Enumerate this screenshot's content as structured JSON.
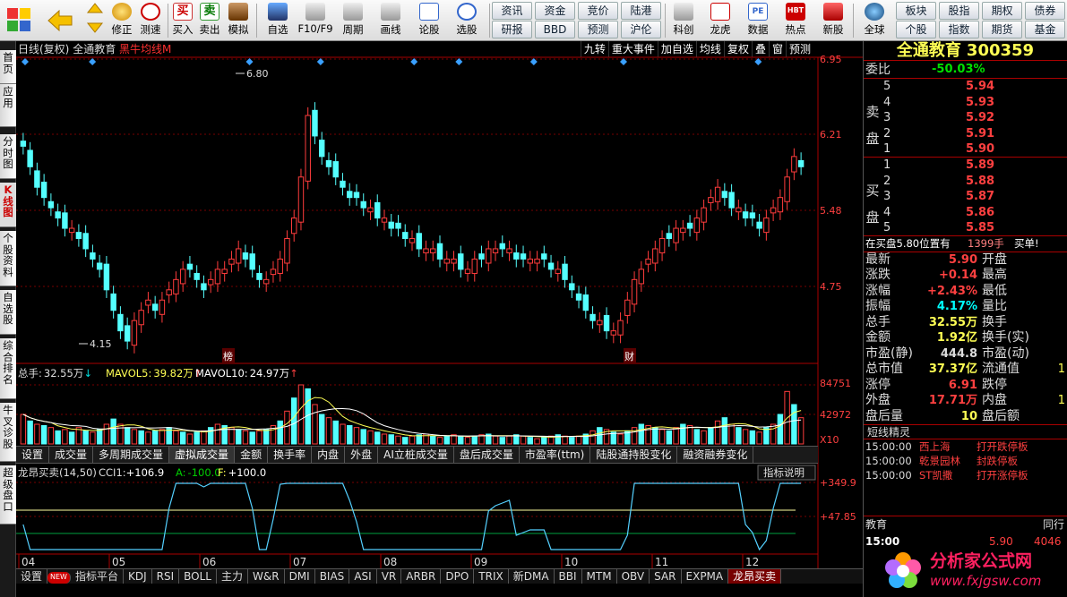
{
  "toolbar": {
    "buttons": [
      "修正",
      "测速",
      "买入",
      "卖出",
      "模拟",
      "自选",
      "F10/F9",
      "周期",
      "画线",
      "论股",
      "选股",
      "科创",
      "龙虎",
      "数据",
      "热点",
      "新股",
      "全球"
    ],
    "buy_glyph": "买",
    "sell_glyph": "卖",
    "grid_buttons": {
      "row1": [
        "资讯",
        "资金",
        "竞价",
        "陆港"
      ],
      "row2": [
        "研报",
        "BBD",
        "预测",
        "沪伦"
      ],
      "right_row1": [
        "板块",
        "股指",
        "期权",
        "债券"
      ],
      "right_row2": [
        "个股",
        "指数",
        "期货",
        "基金"
      ]
    },
    "pe_badge": "PE",
    "hbt_badge": "HBT"
  },
  "sidebar": [
    "首页",
    "应用",
    "分时图",
    "K线图",
    "个股资料",
    "自选股",
    "综合排名",
    "牛叉诊股",
    "超级盘口"
  ],
  "chart": {
    "header_prefix": "日线(复权)",
    "stock_name": "全通教育",
    "formula": "黑牛均线M",
    "tools": [
      "九转",
      "重大事件",
      "加自选",
      "均线",
      "复权",
      "叠",
      "窗",
      "预测"
    ],
    "price_axis": [
      "6.95",
      "6.21",
      "5.48",
      "4.75"
    ],
    "high_label": "6.80",
    "low_label": "4.15",
    "event_bang": "榜",
    "event_cai": "财",
    "vol_header": {
      "zongshou_label": "总手:",
      "zongshou": "32.55万",
      "mavol5_label": "MAVOL5:",
      "mavol5": "39.82万",
      "mavol10_label": "MAVOL10:",
      "mavol10": "24.97万"
    },
    "vol_axis": [
      "84751",
      "42972"
    ],
    "vol_unit": "X10",
    "ind_tabs": [
      "设置",
      "成交量",
      "多周期成交量",
      "虚拟成交量",
      "金额",
      "换手率",
      "内盘",
      "外盘",
      "AI立桩成交量",
      "盘后成交量",
      "市盈率(ttm)",
      "陆股通持股变化",
      "融资融券变化"
    ],
    "ind_tab_selected": "虚拟成交量",
    "ind_explain": "指标说明",
    "ind_header": {
      "name": "龙昂买卖(14,50)",
      "cci_label": "CCI1:",
      "cci": "+106.9",
      "a_label": "A:",
      "a": "-100.0",
      "f_label": "F:",
      "f": "+100.0"
    },
    "ind_axis": [
      "+349.9",
      "+47.85"
    ],
    "months": [
      "04",
      "05",
      "06",
      "07",
      "08",
      "09",
      "10",
      "11",
      "12"
    ],
    "bottom_tabs": [
      "设置",
      "指标平台",
      "KDJ",
      "RSI",
      "BOLL",
      "主力",
      "W&R",
      "DMI",
      "BIAS",
      "ASI",
      "VR",
      "ARBR",
      "DPO",
      "TRIX",
      "新DMA",
      "BBI",
      "MTM",
      "OBV",
      "SAR",
      "EXPMA",
      "龙昂买卖"
    ],
    "new_badge": "NEW"
  },
  "chart_data": {
    "type": "candlestick",
    "title": "全通教育 日线(复权)",
    "price_range": [
      4.0,
      6.95
    ],
    "high": 6.8,
    "low": 4.15,
    "close_series": [
      6.1,
      5.9,
      5.7,
      5.6,
      5.5,
      5.4,
      5.3,
      5.3,
      5.2,
      5.1,
      5.0,
      4.9,
      4.7,
      4.5,
      4.3,
      4.2,
      4.4,
      4.5,
      4.6,
      4.5,
      4.6,
      4.7,
      4.8,
      4.9,
      4.9,
      4.8,
      4.7,
      4.8,
      4.9,
      4.9,
      5.0,
      5.1,
      5.0,
      4.9,
      4.8,
      4.8,
      4.9,
      5.0,
      5.2,
      5.4,
      5.8,
      6.4,
      6.2,
      6.0,
      5.9,
      5.8,
      5.7,
      5.6,
      5.6,
      5.5,
      5.5,
      5.4,
      5.4,
      5.3,
      5.3,
      5.2,
      5.2,
      5.1,
      5.1,
      5.1,
      5.0,
      5.0,
      5.0,
      4.9,
      4.9,
      5.0,
      5.0,
      5.1,
      5.1,
      5.1,
      5.1,
      5.0,
      5.0,
      5.0,
      5.0,
      5.0,
      4.9,
      4.9,
      4.8,
      4.7,
      4.6,
      4.5,
      4.4,
      4.4,
      4.3,
      4.3,
      4.4,
      4.6,
      4.8,
      4.9,
      5.0,
      5.1,
      5.2,
      5.2,
      5.3,
      5.3,
      5.3,
      5.4,
      5.5,
      5.6,
      5.7,
      5.6,
      5.5,
      5.5,
      5.4,
      5.4,
      5.3,
      5.4,
      5.5,
      5.6,
      5.8,
      6.0,
      5.9
    ],
    "vol_series": [
      45,
      35,
      30,
      28,
      25,
      20,
      22,
      18,
      25,
      20,
      18,
      22,
      30,
      38,
      30,
      25,
      22,
      20,
      18,
      20,
      22,
      25,
      20,
      18,
      15,
      18,
      20,
      25,
      30,
      28,
      25,
      22,
      20,
      18,
      20,
      22,
      28,
      35,
      50,
      70,
      90,
      84,
      60,
      45,
      40,
      35,
      30,
      28,
      25,
      22,
      20,
      18,
      15,
      14,
      12,
      10,
      12,
      14,
      15,
      12,
      10,
      12,
      14,
      12,
      10,
      12,
      14,
      15,
      12,
      10,
      12,
      14,
      12,
      10,
      8,
      10,
      12,
      14,
      12,
      10,
      12,
      15,
      20,
      25,
      22,
      18,
      15,
      20,
      25,
      30,
      28,
      25,
      22,
      20,
      25,
      30,
      28,
      22,
      20,
      25,
      35,
      40,
      30,
      25,
      22,
      20,
      18,
      25,
      30,
      45,
      80,
      60,
      40
    ],
    "vol_unit": "X10",
    "indicator": "龙昂买卖(14,50)"
  },
  "quote": {
    "name": "全通教育",
    "code": "300359",
    "weibi_label": "委比",
    "weibi": "-50.03%",
    "sell_label": "卖盘",
    "buy_label": "买盘",
    "sell": [
      {
        "n": "5",
        "p": "5.94"
      },
      {
        "n": "4",
        "p": "5.93"
      },
      {
        "n": "3",
        "p": "5.92"
      },
      {
        "n": "2",
        "p": "5.91"
      },
      {
        "n": "1",
        "p": "5.90"
      }
    ],
    "buy": [
      {
        "n": "1",
        "p": "5.89"
      },
      {
        "n": "2",
        "p": "5.88"
      },
      {
        "n": "3",
        "p": "5.87"
      },
      {
        "n": "4",
        "p": "5.86"
      },
      {
        "n": "5",
        "p": "5.85"
      }
    ],
    "notice_prefix": "在买盘5.80位置有",
    "notice_qty": "1399手",
    "notice_suffix": "买单!",
    "stats": [
      {
        "l": "最新",
        "v": "5.90",
        "vc": "r",
        "l2": "开盘",
        "v2": ""
      },
      {
        "l": "涨跌",
        "v": "+0.14",
        "vc": "r",
        "l2": "最高",
        "v2": ""
      },
      {
        "l": "涨幅",
        "v": "+2.43%",
        "vc": "r",
        "l2": "最低",
        "v2": ""
      },
      {
        "l": "振幅",
        "v": "4.17%",
        "vc": "c",
        "l2": "量比",
        "v2": ""
      },
      {
        "l": "总手",
        "v": "32.55万",
        "vc": "y",
        "l2": "换手",
        "v2": ""
      },
      {
        "l": "金额",
        "v": "1.92亿",
        "vc": "y",
        "l2": "换手(实)",
        "v2": ""
      },
      {
        "l": "市盈(静)",
        "v": "444.8",
        "vc": "w",
        "l2": "市盈(动)",
        "v2": ""
      },
      {
        "l": "总市值",
        "v": "37.37亿",
        "vc": "y",
        "l2": "流通值",
        "v2": "1"
      },
      {
        "l": "涨停",
        "v": "6.91",
        "vc": "r",
        "l2": "跌停",
        "v2": ""
      },
      {
        "l": "外盘",
        "v": "17.71万",
        "vc": "r",
        "l2": "内盘",
        "v2": "1"
      },
      {
        "l": "盘后量",
        "v": "10",
        "vc": "y",
        "l2": "盘后额",
        "v2": ""
      }
    ],
    "news_title": "短线精灵",
    "news": [
      {
        "t": "15:00:00",
        "n": "西上海",
        "e": "打开跌停板"
      },
      {
        "t": "15:00:00",
        "n": "乾景园林",
        "e": "封跌停板"
      },
      {
        "t": "15:00:00",
        "n": "ST凯撒",
        "e": "打开涨停板"
      }
    ],
    "footer_left": "教育",
    "footer_right": "同行",
    "tick_time": "15:00",
    "tick_price": "5.90",
    "tick_vol": "4046"
  },
  "watermark": {
    "cn": "分析家公式网",
    "url": "www.fxjgsw.com"
  },
  "colors": {
    "up": "#ff3c3c",
    "down": "#54ffff",
    "title": "#ffff54",
    "border": "#a00000"
  }
}
